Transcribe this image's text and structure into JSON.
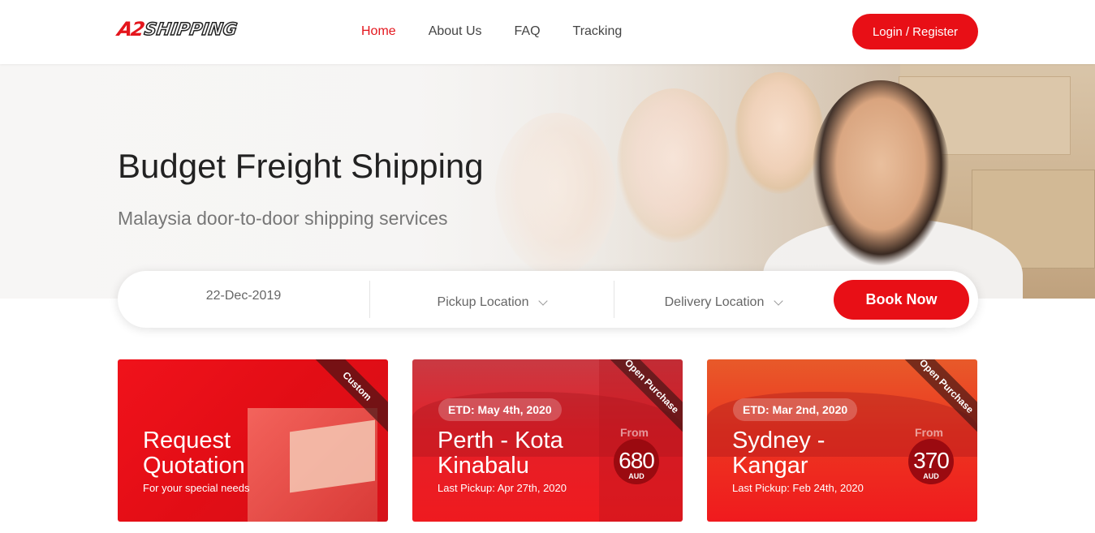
{
  "header": {
    "logo_mark": "A2",
    "logo_word": "SHIPPING",
    "nav": [
      "Home",
      "About Us",
      "FAQ",
      "Tracking"
    ],
    "active_nav": "Home",
    "login_label": "Login / Register"
  },
  "hero": {
    "title": "Budget Freight Shipping",
    "subtitle": "Malaysia door-to-door shipping services"
  },
  "booking": {
    "date": "22-Dec-2019",
    "pickup_placeholder": "Pickup Location",
    "delivery_placeholder": "Delivery Location",
    "book_label": "Book Now"
  },
  "cards": [
    {
      "ribbon": "Custom",
      "title_line1": "Request",
      "title_line2": "Quotation",
      "subtitle": "For your special needs"
    },
    {
      "ribbon": "Open Purchase",
      "etd": "ETD: May 4th, 2020",
      "title_line1": "Perth - Kota",
      "title_line2": "Kinabalu",
      "subtitle": "Last Pickup: Apr 27th, 2020",
      "from_label": "From",
      "price": "680",
      "currency": "AUD"
    },
    {
      "ribbon": "Open Purchase",
      "etd": "ETD: Mar 2nd, 2020",
      "title_line1": "Sydney -",
      "title_line2": "Kangar",
      "subtitle": "Last Pickup: Feb 24th, 2020",
      "from_label": "From",
      "price": "370",
      "currency": "AUD"
    }
  ],
  "colors": {
    "brand_red": "#e80f16",
    "text_dark": "#222222",
    "text_muted": "#777777"
  }
}
